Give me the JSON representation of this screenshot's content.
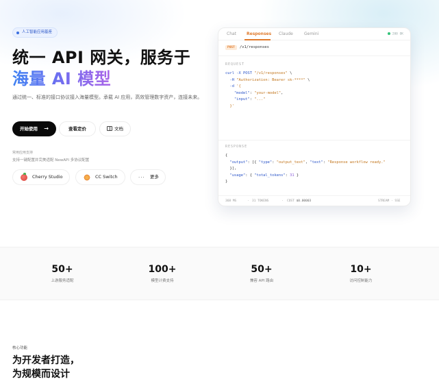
{
  "hero": {
    "badge": "人工智能应用基座",
    "title_line1": "统一 API 网关，服务于",
    "title_line2": "海量 AI 模型",
    "subtitle": "通过统一、标准的接口协议接入海量模型。承载 AI 应用，高效管理数字资产，连接未来。",
    "primary_button": "开始使用",
    "secondary_button": "查看定价",
    "docs_button": "文档",
    "compat_label": "常用应用支持",
    "compat_desc": "支持一键配置并完美适配 NewAPI 多协议配置",
    "integrations": [
      {
        "label": "Cherry Studio",
        "icon": "cherry-icon"
      },
      {
        "label": "CC Switch",
        "icon": "cc-switch-icon"
      },
      {
        "label": "更多",
        "icon": "more-dots-icon"
      }
    ]
  },
  "panel": {
    "tabs": [
      "Chat",
      "Responses",
      "Claude",
      "Gemini"
    ],
    "active_tab": "Responses",
    "latency": "200 OK",
    "method": "POST",
    "path": "/v1/responses",
    "request_label": "REQUEST",
    "response_label": "RESPONSE",
    "request_lines": [
      "curl -X POST \"/v1/responses\" \\",
      "  -H \"Authorization: Bearer sk-****\" \\",
      "  -d '{",
      "    \"model\": \"your-model\",",
      "    \"input\": \"...\"",
      "  }'"
    ],
    "response_lines": [
      "{",
      "  \"output\": [{ \"type\": \"output_text\", \"text\": \"Response workflow ready.\"",
      "  }],",
      "  \"usage\": { \"total_tokens\": 31 }",
      "}"
    ],
    "footer_ms": "368 MS",
    "footer_tokens": "31 TOKENS",
    "footer_cost_label": "COST",
    "footer_cost": "$0.00003",
    "footer_stream": "STREAM · SSE"
  },
  "stats": [
    {
      "value": "50+",
      "label": "上游服务适配"
    },
    {
      "value": "100+",
      "label": "模型计费支持"
    },
    {
      "value": "50+",
      "label": "兼容 API 路由"
    },
    {
      "value": "10+",
      "label": "访问控制能力"
    }
  ],
  "features": {
    "kicker": "核心功能",
    "title_line1": "为开发者打造，",
    "title_line2": "为规模而设计"
  },
  "colors": {
    "accent_orange": "#e07a2c",
    "gradient_start": "#3f82f2",
    "gradient_end": "#a863e8",
    "primary_button_bg": "#0a0a0a",
    "status_green": "#34c37a"
  }
}
